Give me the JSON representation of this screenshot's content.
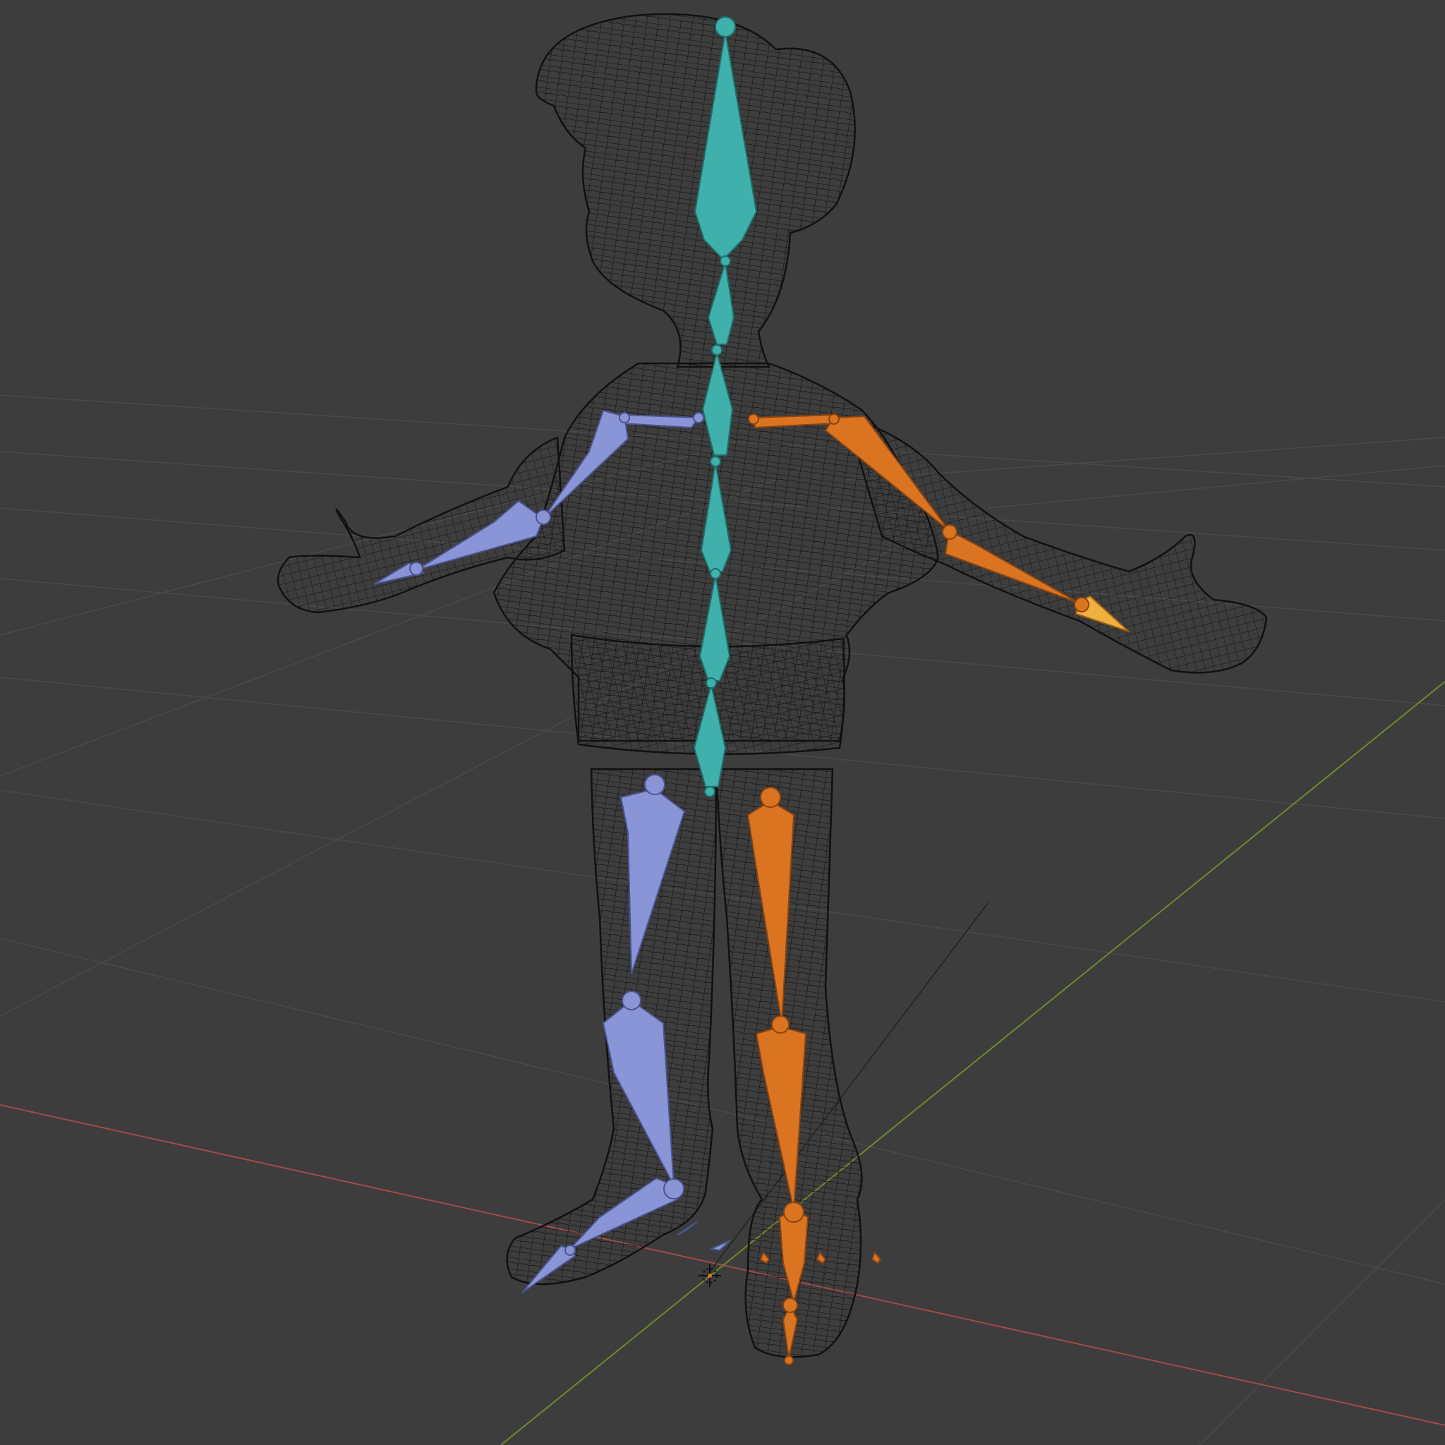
{
  "app": "3D viewport",
  "viewport": {
    "background": "#3d3d3d",
    "grid_color": "#4a4a4a",
    "x_axis_color": "#a34a4a",
    "y_axis_color": "#6c8a2a",
    "wire_color": "#111111"
  },
  "armature": {
    "center_color": "#3fb0ab",
    "left_color": "#8a95d8",
    "right_color": "#db7420",
    "selected_color": "#f0b040"
  },
  "icons": {
    "origin": "origin-cursor-icon"
  }
}
